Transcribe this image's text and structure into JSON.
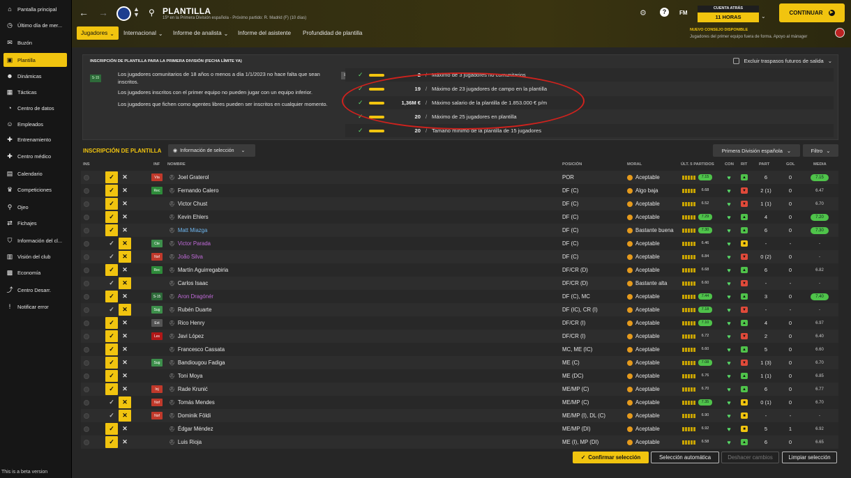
{
  "sidebar": {
    "items": [
      {
        "label": "Pantalla principal",
        "icon": "home-icon"
      },
      {
        "label": "Último día de mer...",
        "icon": "clock-icon"
      },
      {
        "label": "Buzón",
        "icon": "inbox-icon"
      },
      {
        "label": "Plantilla",
        "icon": "shirt-icon"
      },
      {
        "label": "Dinámicas",
        "icon": "people-icon"
      },
      {
        "label": "Tácticas",
        "icon": "tactics-icon"
      },
      {
        "label": "Centro de datos",
        "icon": "chart-icon"
      },
      {
        "label": "Empleados",
        "icon": "staff-icon"
      },
      {
        "label": "Entrenamiento",
        "icon": "training-icon"
      },
      {
        "label": "Centro médico",
        "icon": "medical-icon"
      },
      {
        "label": "Calendario",
        "icon": "calendar-icon"
      },
      {
        "label": "Competiciones",
        "icon": "trophy-icon"
      },
      {
        "label": "Ojeo",
        "icon": "binoculars-icon"
      },
      {
        "label": "Fichajes",
        "icon": "transfer-icon"
      },
      {
        "label": "Información del cl...",
        "icon": "shield-icon"
      },
      {
        "label": "Visión del club",
        "icon": "building-icon"
      },
      {
        "label": "Economía",
        "icon": "money-icon"
      },
      {
        "label": "Centro Desarr.",
        "icon": "development-icon"
      },
      {
        "label": "Notificar error",
        "icon": "alert-icon"
      }
    ],
    "beta": "This is a beta version"
  },
  "header": {
    "title": "PLANTILLA",
    "subtitle": "15º en la Primera División española - Próximo partido: R. Madrid (F) (10 días)",
    "tabs": [
      "Jugadores",
      "Internacional",
      "Informe de analista",
      "Informe del asistente",
      "Profundidad de plantilla"
    ],
    "fm": "FM",
    "countdown_label": "CUENTA ATRÁS",
    "countdown_value": "11 HORAS",
    "continue": "CONTINUAR",
    "advice_title": "NUEVO CONSEJO DISPONIBLE",
    "advice_text": "Jugadores del primer equipo fuera de forma. Apoyo al mánager"
  },
  "info": {
    "title": "INSCRIPCIÓN DE PLANTILLA PARA LA PRIMERA DIVISIÓN (FECHA LÍMITE YA)",
    "exclude_label": "Excluir traspasos futuros de salida",
    "badge": "S-15",
    "ext_badge": "Ext",
    "rules": [
      "Los jugadores comunitarios de 18 años o menos a día 1/1/2023 no hace falta que sean inscritos.",
      "Los jugadores inscritos con el primer equipo no pueden jugar con un equipo inferior.",
      "Los jugadores que fichen como agentes libres pueden ser inscritos en cualquier momento."
    ],
    "limits": [
      {
        "value": "2",
        "text": "Máximo de 3 jugadores no comunitarios"
      },
      {
        "value": "19",
        "text": "Máximo de 23 jugadores de campo en la plantilla"
      },
      {
        "value": "1,36M €",
        "text": "Máximo salario de la plantilla de 1.853.000 € p/m"
      },
      {
        "value": "20",
        "text": "Máximo de 25 jugadores en plantilla"
      },
      {
        "value": "20",
        "text": "Tamaño mínimo de la plantilla de 15 jugadores"
      }
    ]
  },
  "table": {
    "section_title": "INSCRIPCIÓN DE PLANTILLA",
    "selection_info": "Información de selección",
    "division": "Primera División española",
    "filter": "Filtro",
    "columns": {
      "ins": "INS",
      "inf": "INF",
      "name": "NOMBRE",
      "pos": "POSICIÓN",
      "moral": "MORAL",
      "form": "ÚLT. 5 PARTIDOS",
      "con": "CON",
      "rit": "RIT",
      "part": "PART",
      "gol": "GOL",
      "media": "MEDIA"
    },
    "rows": [
      {
        "y": true,
        "inf": "Vta",
        "infc": "#c0392b",
        "name": "Joel Graterol",
        "pos": "POR",
        "moral": "Aceptable",
        "form": "7.15",
        "fg": true,
        "rit": "up",
        "part": "6",
        "gol": "0",
        "media": "7.15",
        "mg": true,
        "nc": "#e8e8e8"
      },
      {
        "y": true,
        "inf": "Rec",
        "infc": "#2e8b3a",
        "name": "Fernando Calero",
        "pos": "DF (C)",
        "moral": "Algo baja",
        "form": "6.68",
        "fg": false,
        "rit": "down",
        "part": "2 (1)",
        "gol": "0",
        "media": "6.47",
        "mg": false,
        "nc": "#e8e8e8"
      },
      {
        "y": true,
        "inf": "",
        "infc": "",
        "name": "Victor Chust",
        "pos": "DF (C)",
        "moral": "Aceptable",
        "form": "6.52",
        "fg": false,
        "rit": "down",
        "part": "1 (1)",
        "gol": "0",
        "media": "6.70",
        "mg": false,
        "nc": "#e8e8e8"
      },
      {
        "y": true,
        "inf": "",
        "infc": "",
        "name": "Kevin Ehlers",
        "pos": "DF (C)",
        "moral": "Aceptable",
        "form": "7.29",
        "fg": true,
        "rit": "up",
        "part": "4",
        "gol": "0",
        "media": "7.20",
        "mg": true,
        "nc": "#e8e8e8"
      },
      {
        "y": true,
        "inf": "",
        "infc": "",
        "name": "Matt Miazga",
        "pos": "DF (C)",
        "moral": "Bastante buena",
        "form": "7.30",
        "fg": true,
        "rit": "up",
        "part": "6",
        "gol": "0",
        "media": "7.30",
        "mg": true,
        "nc": "#6fb7f0"
      },
      {
        "y": false,
        "inf": "Cte",
        "infc": "#3d8f4b",
        "name": "Victor Parada",
        "pos": "DF (C)",
        "moral": "Aceptable",
        "form": "6.46",
        "fg": false,
        "rit": "mid",
        "part": "-",
        "gol": "-",
        "media": "-",
        "mg": false,
        "nc": "#c06ad9"
      },
      {
        "y": false,
        "inf": "Nof",
        "infc": "#c0392b",
        "name": "João Silva",
        "pos": "DF (C)",
        "moral": "Aceptable",
        "form": "6.84",
        "fg": false,
        "rit": "down",
        "part": "0 (2)",
        "gol": "0",
        "media": "-",
        "mg": false,
        "nc": "#c06ad9"
      },
      {
        "y": true,
        "inf": "Rec",
        "infc": "#2e8b3a",
        "name": "Martín Aguirregabiria",
        "pos": "DF/CR (D)",
        "moral": "Aceptable",
        "form": "6.68",
        "fg": false,
        "rit": "up",
        "part": "6",
        "gol": "0",
        "media": "6.82",
        "mg": false,
        "nc": "#e8e8e8"
      },
      {
        "y": false,
        "inf": "",
        "infc": "",
        "name": "Carlos Isaac",
        "pos": "DF/CR (D)",
        "moral": "Bastante alta",
        "form": "6.60",
        "fg": false,
        "rit": "down",
        "part": "-",
        "gol": "-",
        "media": "-",
        "mg": false,
        "nc": "#e8e8e8"
      },
      {
        "y": true,
        "inf": "S-15",
        "infc": "#2e6b3a",
        "name": "Aron Dragónér",
        "pos": "DF (C), MC",
        "moral": "Aceptable",
        "form": "7.44",
        "fg": true,
        "rit": "up",
        "part": "3",
        "gol": "0",
        "media": "7.40",
        "mg": true,
        "nc": "#c06ad9"
      },
      {
        "y": false,
        "inf": "Sug",
        "infc": "#3d8f4b",
        "name": "Rubén Duarte",
        "pos": "DF (IC), CR (I)",
        "moral": "Aceptable",
        "form": "7.18",
        "fg": true,
        "rit": "down",
        "part": "-",
        "gol": "-",
        "media": "-",
        "mg": false,
        "nc": "#e8e8e8"
      },
      {
        "y": true,
        "inf": "Ext",
        "infc": "#555",
        "name": "Rico Henry",
        "pos": "DF/CR (I)",
        "moral": "Aceptable",
        "form": "7.10",
        "fg": true,
        "rit": "up",
        "part": "4",
        "gol": "0",
        "media": "6.97",
        "mg": false,
        "nc": "#e8e8e8"
      },
      {
        "y": true,
        "inf": "Les",
        "infc": "#b01717",
        "name": "Javi López",
        "pos": "DF/CR (I)",
        "moral": "Aceptable",
        "form": "6.72",
        "fg": false,
        "rit": "down",
        "part": "2",
        "gol": "0",
        "media": "6.40",
        "mg": false,
        "nc": "#e8e8e8"
      },
      {
        "y": true,
        "inf": "",
        "infc": "",
        "name": "Francesco Cassata",
        "pos": "MC, ME (IC)",
        "moral": "Aceptable",
        "form": "6.60",
        "fg": false,
        "rit": "up",
        "part": "5",
        "gol": "0",
        "media": "6.60",
        "mg": false,
        "nc": "#e8e8e8"
      },
      {
        "y": true,
        "inf": "Sug",
        "infc": "#3d8f4b",
        "name": "Bandiougou Fadiga",
        "pos": "ME (C)",
        "moral": "Aceptable",
        "form": "7.08",
        "fg": true,
        "rit": "down",
        "part": "1 (3)",
        "gol": "0",
        "media": "6.70",
        "mg": false,
        "nc": "#e8e8e8"
      },
      {
        "y": true,
        "inf": "",
        "infc": "",
        "name": "Toni Moya",
        "pos": "ME (DC)",
        "moral": "Aceptable",
        "form": "6.76",
        "fg": false,
        "rit": "up",
        "part": "1 (1)",
        "gol": "0",
        "media": "6.85",
        "mg": false,
        "nc": "#e8e8e8"
      },
      {
        "y": true,
        "inf": "Inj",
        "infc": "#c0392b",
        "name": "Rade Krunić",
        "pos": "ME/MP (C)",
        "moral": "Aceptable",
        "form": "6.70",
        "fg": false,
        "rit": "up",
        "part": "6",
        "gol": "0",
        "media": "6.77",
        "mg": false,
        "nc": "#e8e8e8"
      },
      {
        "y": false,
        "inf": "Nof",
        "infc": "#c0392b",
        "name": "Tomás Mendes",
        "pos": "ME/MP (C)",
        "moral": "Aceptable",
        "form": "7.35",
        "fg": true,
        "rit": "mid",
        "part": "0 (1)",
        "gol": "0",
        "media": "6.70",
        "mg": false,
        "nc": "#e8e8e8"
      },
      {
        "y": false,
        "inf": "Nof",
        "infc": "#c0392b",
        "name": "Dominik Földi",
        "pos": "ME/MP (I), DL (C)",
        "moral": "Aceptable",
        "form": "6.90",
        "fg": false,
        "rit": "mid",
        "part": "-",
        "gol": "-",
        "media": "-",
        "mg": false,
        "nc": "#e8e8e8"
      },
      {
        "y": true,
        "inf": "",
        "infc": "",
        "name": "Édgar Méndez",
        "pos": "ME/MP (DI)",
        "moral": "Aceptable",
        "form": "6.92",
        "fg": false,
        "rit": "mid",
        "part": "5",
        "gol": "1",
        "media": "6.92",
        "mg": false,
        "nc": "#e8e8e8"
      },
      {
        "y": true,
        "inf": "",
        "infc": "",
        "name": "Luis Rioja",
        "pos": "ME (I), MP (DI)",
        "moral": "Aceptable",
        "form": "6.58",
        "fg": false,
        "rit": "up",
        "part": "6",
        "gol": "0",
        "media": "6.65",
        "mg": false,
        "nc": "#e8e8e8"
      }
    ]
  },
  "footer": {
    "confirm": "Confirmar selección",
    "auto": "Selección automática",
    "undo": "Deshacer cambios",
    "clear": "Limpiar selección"
  },
  "colors": {
    "accent": "#f1c40f",
    "annotation": "#d0221d",
    "positive": "#4fc34a"
  }
}
